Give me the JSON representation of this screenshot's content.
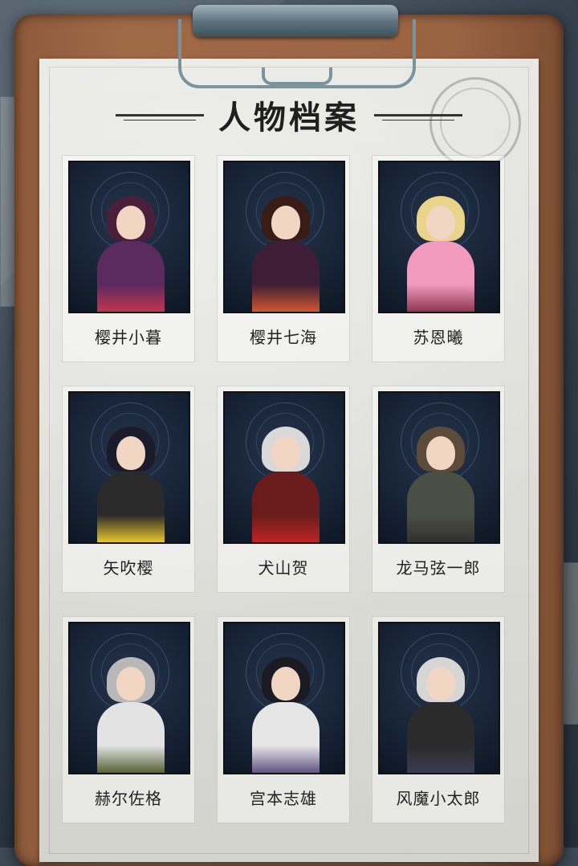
{
  "title": "人物档案",
  "characters": [
    {
      "name": "樱井小暮",
      "hair": "#4a1f3a",
      "outfit": "#5b2a5e",
      "accent": "#c8354e"
    },
    {
      "name": "樱井七海",
      "hair": "#3a1c16",
      "outfit": "#3e1d37",
      "accent": "#d95a2b"
    },
    {
      "name": "苏恩曦",
      "hair": "#e9d489",
      "outfit": "#f29bbf",
      "accent": "#8a2f4a"
    },
    {
      "name": "矢吹樱",
      "hair": "#1b1b2b",
      "outfit": "#2a2a2a",
      "accent": "#f1d02c"
    },
    {
      "name": "犬山贺",
      "hair": "#d9d9d9",
      "outfit": "#6a1c1c",
      "accent": "#c12424"
    },
    {
      "name": "龙马弦一郎",
      "hair": "#5c4a3b",
      "outfit": "#4a4f45",
      "accent": "#2f2f2f"
    },
    {
      "name": "赫尔佐格",
      "hair": "#b8b8b8",
      "outfit": "#e3e3e3",
      "accent": "#4e5a2a"
    },
    {
      "name": "宫本志雄",
      "hair": "#1a1a22",
      "outfit": "#e6e6e6",
      "accent": "#5a4a7a"
    },
    {
      "name": "风魔小太郎",
      "hair": "#d6d6d6",
      "outfit": "#2b2b2b",
      "accent": "#3b3b55"
    }
  ]
}
